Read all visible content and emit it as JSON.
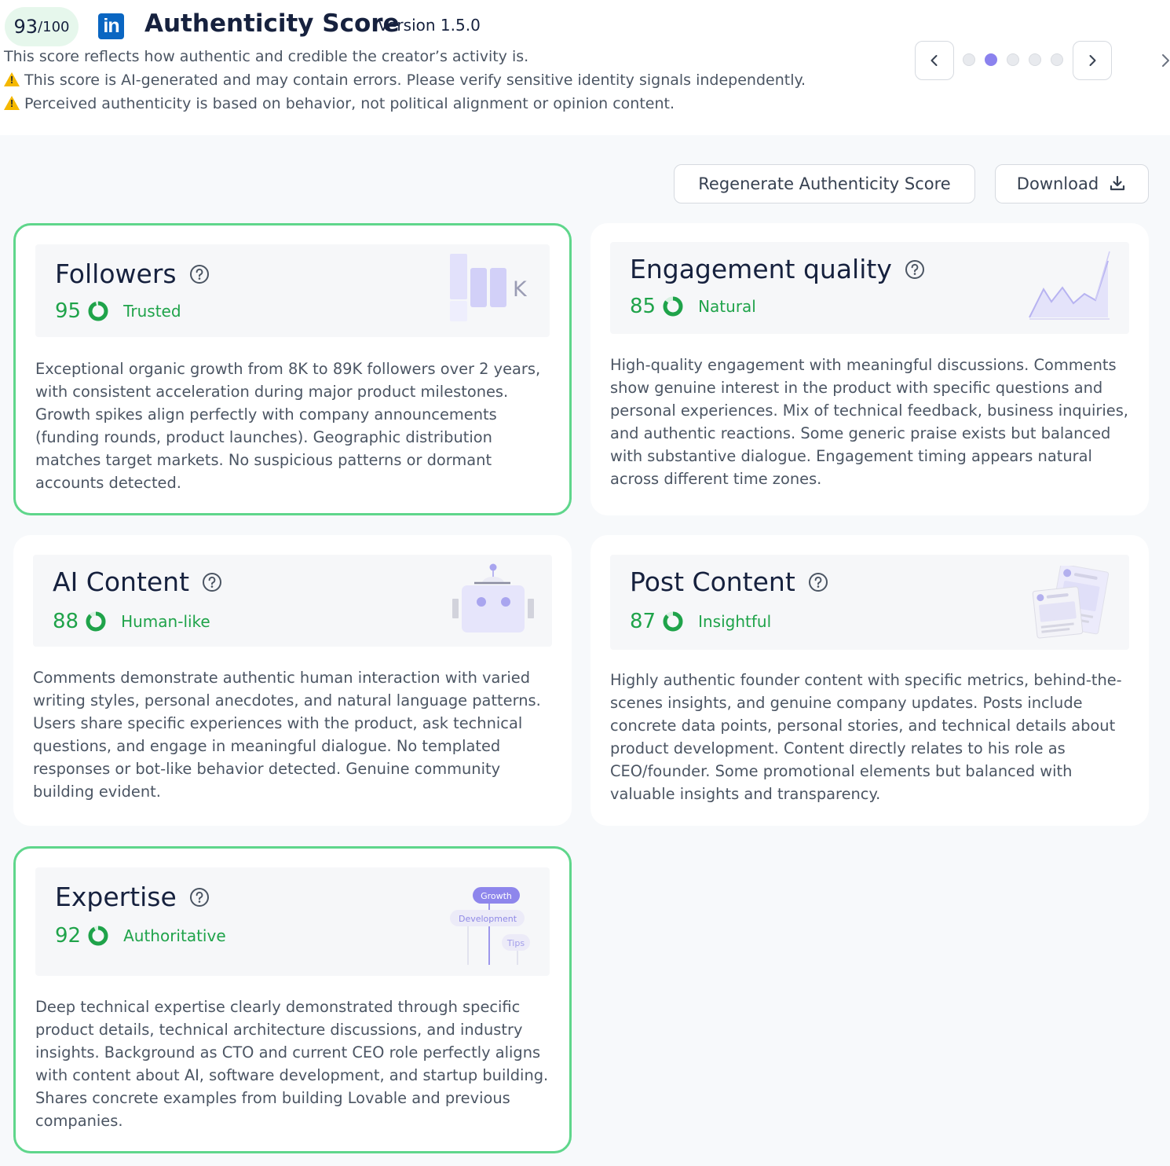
{
  "header": {
    "score": "93",
    "score_max": "/100",
    "logo": "linkedin-logo",
    "logo_text": "in",
    "title": "Authenticity Score",
    "version": "Version 1.5.0",
    "description": "This score reflects how authentic and credible the creator’s activity is.",
    "warning_1": "This score is AI-generated and may contain errors. Please verify sensitive identity signals independently.",
    "warning_2": "Perceived authenticity is based on behavior, not political alignment or opinion content."
  },
  "pager": {
    "total": 5,
    "active_index": 1
  },
  "actions": {
    "regenerate_label": "Regenerate Authenticity Score",
    "download_label": "Download"
  },
  "colors": {
    "accent_green": "#1fa34a",
    "highlight_border": "#5fd68b",
    "active_dot": "#8b82ee",
    "linkedin_blue": "#0a66c2"
  },
  "cards": [
    {
      "title": "Followers",
      "score": "95",
      "score_fraction": 0.95,
      "label": "Trusted",
      "highlighted": true,
      "illustration": "follower-bars-illustration",
      "illustration_text": "K",
      "body": "Exceptional organic growth from 8K to 89K followers over 2 years, with consistent acceleration during major product milestones. Growth spikes align perfectly with company announcements (funding rounds, product launches). Geographic distribution matches target markets. No suspicious patterns or dormant accounts detected."
    },
    {
      "title": "Engagement quality",
      "score": "85",
      "score_fraction": 0.85,
      "label": "Natural",
      "highlighted": false,
      "illustration": "engagement-line-chart-illustration",
      "body": "High-quality engagement with meaningful discussions. Comments show genuine interest in the product with specific questions and personal experiences. Mix of technical feedback, business inquiries, and authentic reactions. Some generic praise exists but balanced with substantive dialogue. Engagement timing appears natural across different time zones."
    },
    {
      "title": "AI Content",
      "score": "88",
      "score_fraction": 0.88,
      "label": "Human-like",
      "highlighted": false,
      "illustration": "robot-illustration",
      "body": "Comments demonstrate authentic human interaction with varied writing styles, personal anecdotes, and natural language patterns. Users share specific experiences with the product, ask technical questions, and engage in meaningful dialogue. No templated responses or bot-like behavior detected. Genuine community building evident."
    },
    {
      "title": "Post Content",
      "score": "87",
      "score_fraction": 0.87,
      "label": "Insightful",
      "highlighted": false,
      "illustration": "post-cards-illustration",
      "body": "Highly authentic founder content with specific metrics, behind-the-scenes insights, and genuine company updates. Posts include concrete data points, personal stories, and technical details about product development. Content directly relates to his role as CEO/founder. Some promotional elements but balanced with valuable insights and transparency."
    },
    {
      "title": "Expertise",
      "score": "92",
      "score_fraction": 0.92,
      "label": "Authoritative",
      "highlighted": true,
      "illustration": "topic-tree-illustration",
      "tags": [
        "Growth",
        "Development",
        "Tips"
      ],
      "body": "Deep technical expertise clearly demonstrated through specific product details, technical architecture discussions, and industry insights. Background as CTO and current CEO role perfectly aligns with content about AI, software development, and startup building. Shares concrete examples from building Lovable and previous companies."
    }
  ]
}
